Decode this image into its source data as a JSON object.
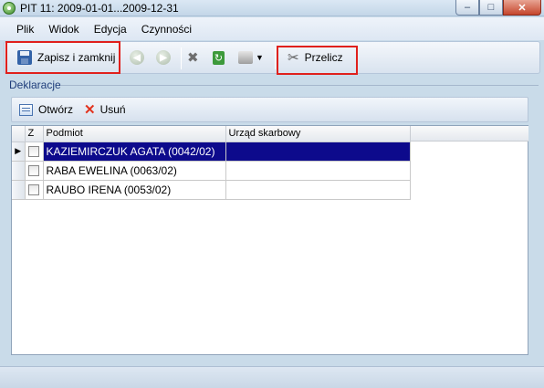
{
  "window": {
    "title": "PIT 11: 2009-01-01...2009-12-31",
    "minimize_label": "–",
    "maximize_label": "□",
    "close_label": "✕"
  },
  "menu": {
    "items": [
      {
        "label": "Plik"
      },
      {
        "label": "Widok"
      },
      {
        "label": "Edycja"
      },
      {
        "label": "Czynności"
      }
    ]
  },
  "toolbar": {
    "save_close_label": "Zapisz i zamknij",
    "back_icon": "arrow-left-icon",
    "forward_icon": "arrow-right-icon",
    "recalc_label": "Przelicz"
  },
  "section": {
    "label": "Deklaracje"
  },
  "subtoolbar": {
    "open_label": "Otwórz",
    "delete_label": "Usuń"
  },
  "grid": {
    "columns": [
      "Z",
      "Podmiot",
      "Urząd skarbowy"
    ],
    "rows": [
      {
        "name": "KAZIEMIRCZUK AGATA (0042/02)",
        "office": "",
        "selected": true
      },
      {
        "name": "RABA EWELINA (0063/02)",
        "office": "",
        "selected": false
      },
      {
        "name": "RAUBO IRENA (0053/02)",
        "office": "",
        "selected": false
      }
    ]
  },
  "colors": {
    "highlight": "#e0201c",
    "selection": "#0d0a8c"
  }
}
